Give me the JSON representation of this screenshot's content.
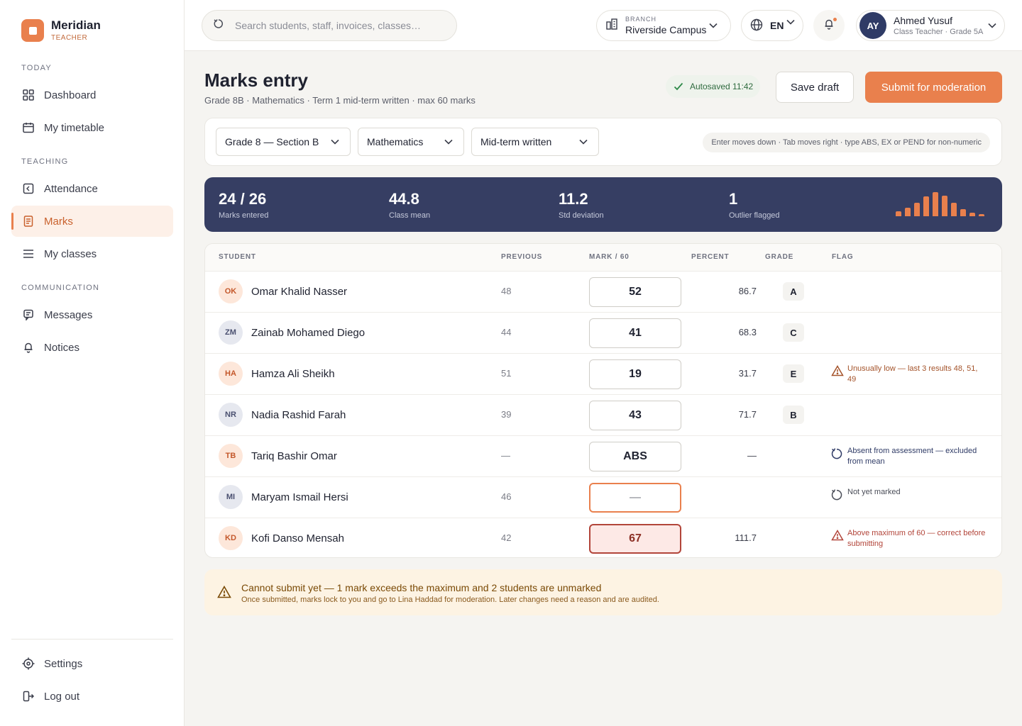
{
  "brand": {
    "name": "Meridian",
    "role": "TEACHER"
  },
  "nav": {
    "sections": {
      "today": "TODAY",
      "teaching": "TEACHING",
      "communication": "COMMUNICATION"
    },
    "items": {
      "dashboard": "Dashboard",
      "timetable": "My timetable",
      "attendance": "Attendance",
      "marks": "Marks",
      "classes": "My classes",
      "messages": "Messages",
      "notices": "Notices",
      "settings": "Settings",
      "logout": "Log out"
    }
  },
  "topbar": {
    "search_placeholder": "Search students, staff, invoices, classes…",
    "branch_label": "BRANCH",
    "branch_value": "Riverside Campus",
    "language": "EN",
    "user": {
      "initials": "AY",
      "name": "Ahmed Yusuf",
      "role": "Class Teacher · Grade 5A"
    }
  },
  "header": {
    "title": "Marks entry",
    "subtitle": "Grade 8B · Mathematics · Term 1 mid-term written · max 60 marks",
    "autosaved": "Autosaved 11:42",
    "save_draft": "Save draft",
    "submit": "Submit for moderation"
  },
  "filters": {
    "section": "Grade 8 — Section B",
    "subject": "Mathematics",
    "assessment": "Mid-term written",
    "hint": "Enter moves down · Tab moves right · type ABS, EX or PEND for non-numeric"
  },
  "stats": {
    "entered": {
      "value": "24 / 26",
      "label": "Marks entered"
    },
    "mean": {
      "value": "44.8",
      "label": "Class mean"
    },
    "std": {
      "value": "11.2",
      "label": "Std deviation"
    },
    "outliers": {
      "value": "1",
      "label": "Outlier flagged"
    },
    "distribution": [
      0.2,
      0.35,
      0.55,
      0.82,
      1.0,
      0.85,
      0.55,
      0.3,
      0.15,
      0.08
    ]
  },
  "table": {
    "headers": {
      "student": "STUDENT",
      "previous": "PREVIOUS",
      "mark": "MARK / 60",
      "percent": "PERCENT",
      "grade": "GRADE",
      "flag": "FLAG"
    },
    "rows": [
      {
        "initials": "OK",
        "name": "Omar Khalid Nasser",
        "previous": "48",
        "mark": "52",
        "percent": "86.7",
        "grade": "A",
        "flag": "",
        "flag_type": "none",
        "tone": "warm",
        "state": "ok"
      },
      {
        "initials": "ZM",
        "name": "Zainab Mohamed Diego",
        "previous": "44",
        "mark": "41",
        "percent": "68.3",
        "grade": "C",
        "flag": "",
        "flag_type": "none",
        "tone": "cool",
        "state": "ok"
      },
      {
        "initials": "HA",
        "name": "Hamza Ali Sheikh",
        "previous": "51",
        "mark": "19",
        "percent": "31.7",
        "grade": "E",
        "flag": "Unusually low — last 3 results 48, 51, 49",
        "flag_type": "warn",
        "tone": "warm",
        "state": "ok"
      },
      {
        "initials": "NR",
        "name": "Nadia Rashid Farah",
        "previous": "39",
        "mark": "43",
        "percent": "71.7",
        "grade": "B",
        "flag": "",
        "flag_type": "none",
        "tone": "cool",
        "state": "ok"
      },
      {
        "initials": "TB",
        "name": "Tariq Bashir Omar",
        "previous": "—",
        "mark": "ABS",
        "percent": "—",
        "grade": "",
        "flag": "Absent from assessment — excluded from mean",
        "flag_type": "abs",
        "tone": "warm",
        "state": "ok"
      },
      {
        "initials": "MI",
        "name": "Maryam Ismail Hersi",
        "previous": "46",
        "mark": "—",
        "percent": "",
        "grade": "",
        "flag": "Not yet marked",
        "flag_type": "pend",
        "tone": "cool",
        "state": "pending"
      },
      {
        "initials": "KD",
        "name": "Kofi Danso Mensah",
        "previous": "42",
        "mark": "67",
        "percent": "111.7",
        "grade": "",
        "flag": "Above maximum of 60 — correct before submitting",
        "flag_type": "err",
        "tone": "warm",
        "state": "error"
      }
    ]
  },
  "alert": {
    "title": "Cannot submit yet — 1 mark exceeds the maximum and 2 students are unmarked",
    "body": "Once submitted, marks lock to you and go to Lina Haddad for moderation. Later changes need a reason and are audited."
  }
}
